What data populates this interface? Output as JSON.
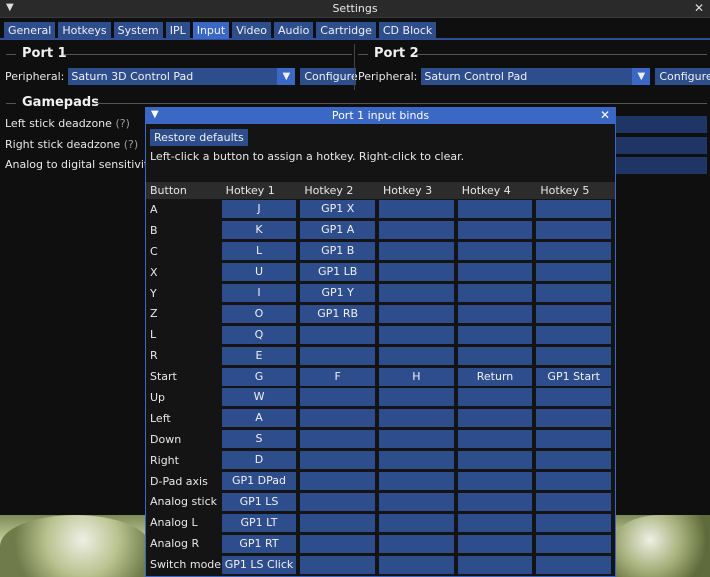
{
  "window": {
    "title": "Settings"
  },
  "tabs": [
    "General",
    "Hotkeys",
    "System",
    "IPL",
    "Input",
    "Video",
    "Audio",
    "Cartridge",
    "CD Block"
  ],
  "active_tab": "Input",
  "port1": {
    "header": "Port 1",
    "peripheral_label": "Peripheral:",
    "peripheral_value": "Saturn 3D Control Pad",
    "configure_label": "Configure"
  },
  "port2": {
    "header": "Port 2",
    "peripheral_label": "Peripheral:",
    "peripheral_value": "Saturn Control Pad",
    "configure_label": "Configure"
  },
  "gamepads": {
    "header": "Gamepads",
    "left_deadzone_label": "Left stick deadzone",
    "right_deadzone_label": "Right stick deadzone",
    "help_marker": "(?)",
    "analog_sensitivity_label": "Analog to digital sensitivity"
  },
  "popup": {
    "title": "Port 1 input binds",
    "restore_label": "Restore defaults",
    "hint": "Left-click a button to assign a hotkey. Right-click to clear.",
    "columns": [
      "Button",
      "Hotkey 1",
      "Hotkey 2",
      "Hotkey 3",
      "Hotkey 4",
      "Hotkey 5"
    ],
    "rows": [
      [
        "A",
        "J",
        "GP1 X",
        "",
        "",
        ""
      ],
      [
        "B",
        "K",
        "GP1 A",
        "",
        "",
        ""
      ],
      [
        "C",
        "L",
        "GP1 B",
        "",
        "",
        ""
      ],
      [
        "X",
        "U",
        "GP1 LB",
        "",
        "",
        ""
      ],
      [
        "Y",
        "I",
        "GP1 Y",
        "",
        "",
        ""
      ],
      [
        "Z",
        "O",
        "GP1 RB",
        "",
        "",
        ""
      ],
      [
        "L",
        "Q",
        "",
        "",
        "",
        ""
      ],
      [
        "R",
        "E",
        "",
        "",
        "",
        ""
      ],
      [
        "Start",
        "G",
        "F",
        "H",
        "Return",
        "GP1 Start"
      ],
      [
        "Up",
        "W",
        "",
        "",
        "",
        ""
      ],
      [
        "Left",
        "A",
        "",
        "",
        "",
        ""
      ],
      [
        "Down",
        "S",
        "",
        "",
        "",
        ""
      ],
      [
        "Right",
        "D",
        "",
        "",
        "",
        ""
      ],
      [
        "D-Pad axis",
        "GP1 DPad",
        "",
        "",
        "",
        ""
      ],
      [
        "Analog stick",
        "GP1 LS",
        "",
        "",
        "",
        ""
      ],
      [
        "Analog L",
        "GP1 LT",
        "",
        "",
        "",
        ""
      ],
      [
        "Analog R",
        "GP1 RT",
        "",
        "",
        "",
        ""
      ],
      [
        "Switch mode",
        "GP1 LS Click",
        "",
        "",
        "",
        ""
      ]
    ]
  },
  "icons": {
    "collapse": "triangle-down-icon",
    "close": "close-icon",
    "dropdown": "dropdown-arrow-icon"
  },
  "colors": {
    "accent": "#3b68c4",
    "button": "#2d4d8c",
    "background": "#0f0f0f"
  }
}
